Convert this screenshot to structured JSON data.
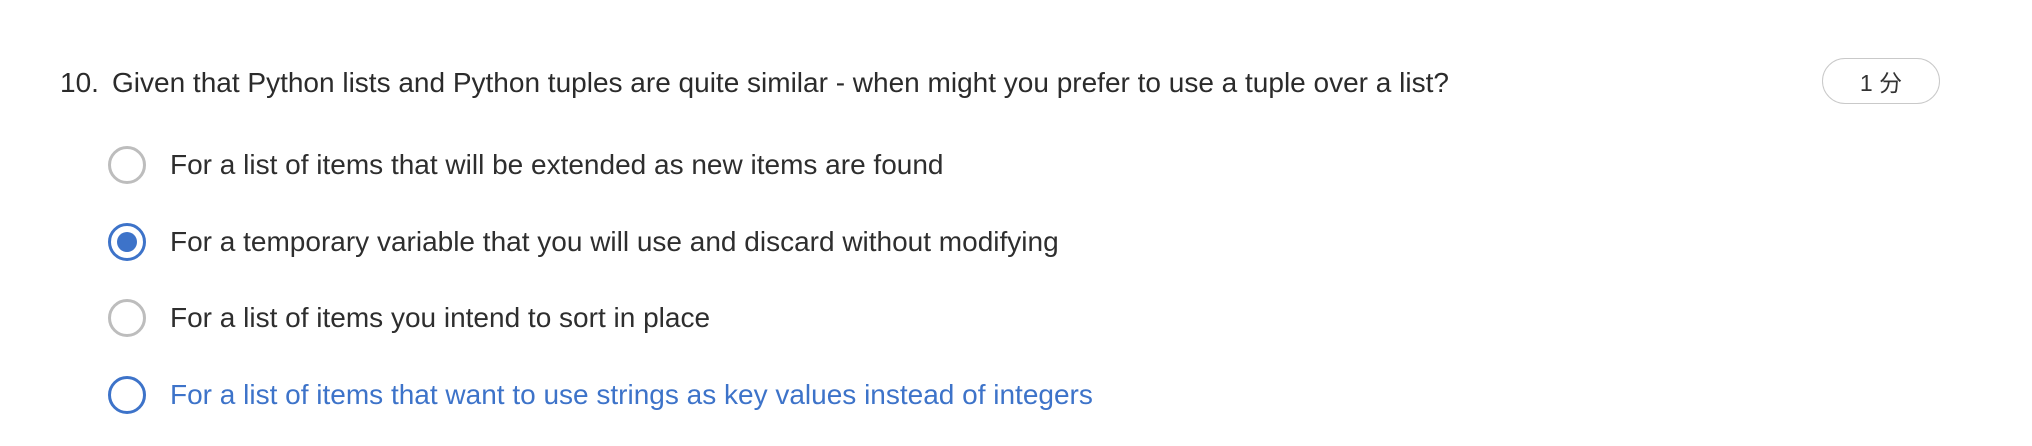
{
  "question": {
    "number": "10.",
    "text": "Given that Python lists and Python tuples are quite similar - when might you prefer to use a tuple over a list?",
    "points": "1 分"
  },
  "options": [
    {
      "label": "For a list of items that will be extended as new items are found",
      "state": "unselected"
    },
    {
      "label": "For a temporary variable that you will use and discard without modifying",
      "state": "selected"
    },
    {
      "label": "For a list of items you intend to sort in place",
      "state": "unselected"
    },
    {
      "label": "For a list of items that want to use strings as key values instead of integers",
      "state": "hovered"
    }
  ],
  "colors": {
    "accent": "#3d73c9",
    "text": "#2e2e2e",
    "radio_border": "#bdbdbd",
    "badge_border": "#c9c9c9"
  }
}
